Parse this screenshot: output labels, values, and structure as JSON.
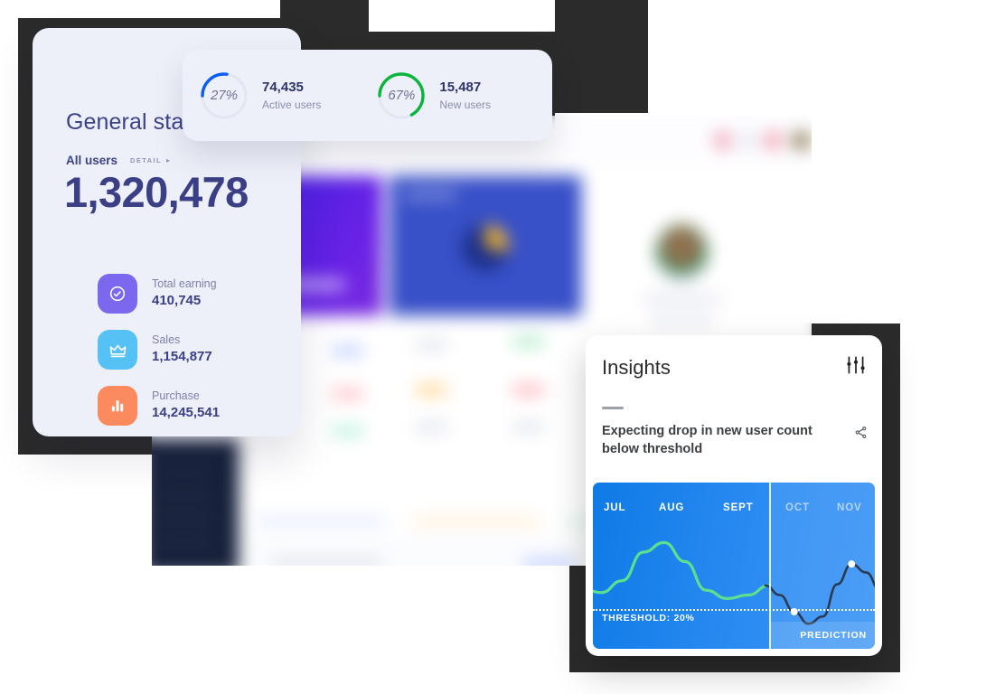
{
  "general_card": {
    "title": "General stat",
    "subtitle_label": "All users",
    "detail_link": "DETAIL",
    "detail_arrow": "▸",
    "total_value": "1,320,478",
    "stats": [
      {
        "icon": "check-circle-icon",
        "label": "Total earning",
        "value": "410,745",
        "color": "#7b68ee"
      },
      {
        "icon": "crown-icon",
        "label": "Sales",
        "value": "1,154,877",
        "color": "#56c1f5"
      },
      {
        "icon": "bar-chart-icon",
        "label": "Purchase",
        "value": "14,245,541",
        "color": "#fb8a5e"
      }
    ]
  },
  "metrics_pill": {
    "rings": [
      {
        "percent_label": "27%",
        "percent": 27,
        "value": "74,435",
        "caption": "Active users",
        "color": "#0b5cf5",
        "track": "#e2e5f2"
      },
      {
        "percent_label": "67%",
        "percent": 67,
        "value": "15,487",
        "caption": "New users",
        "color": "#09b53c",
        "track": "#e2e5f2"
      }
    ]
  },
  "insights_card": {
    "title": "Insights",
    "tune_icon": "sliders-icon",
    "share_icon": "share-icon",
    "message": "Expecting drop in new user count below threshold",
    "chart_data": {
      "type": "line",
      "title": "Insights",
      "categories": [
        "JUL",
        "AUG",
        "SEPT",
        "OCT",
        "NOV"
      ],
      "dimmed_categories": [
        "OCT",
        "NOV"
      ],
      "series": [
        {
          "name": "actual",
          "color": "#5ce08f",
          "values": [
            42,
            38,
            48,
            72,
            80,
            64,
            40,
            33,
            36,
            44
          ]
        },
        {
          "name": "prediction",
          "color": "#2b3a52",
          "values": [
            44,
            36,
            22,
            12,
            18,
            45,
            62,
            55,
            40
          ]
        }
      ],
      "threshold": 20,
      "threshold_label": "THRESHOLD: 20%",
      "prediction_label": "PREDICTION",
      "divider_at": "OCT",
      "prediction_points": 2,
      "grid": false,
      "legend": "none",
      "ylim": [
        0,
        100
      ]
    }
  }
}
